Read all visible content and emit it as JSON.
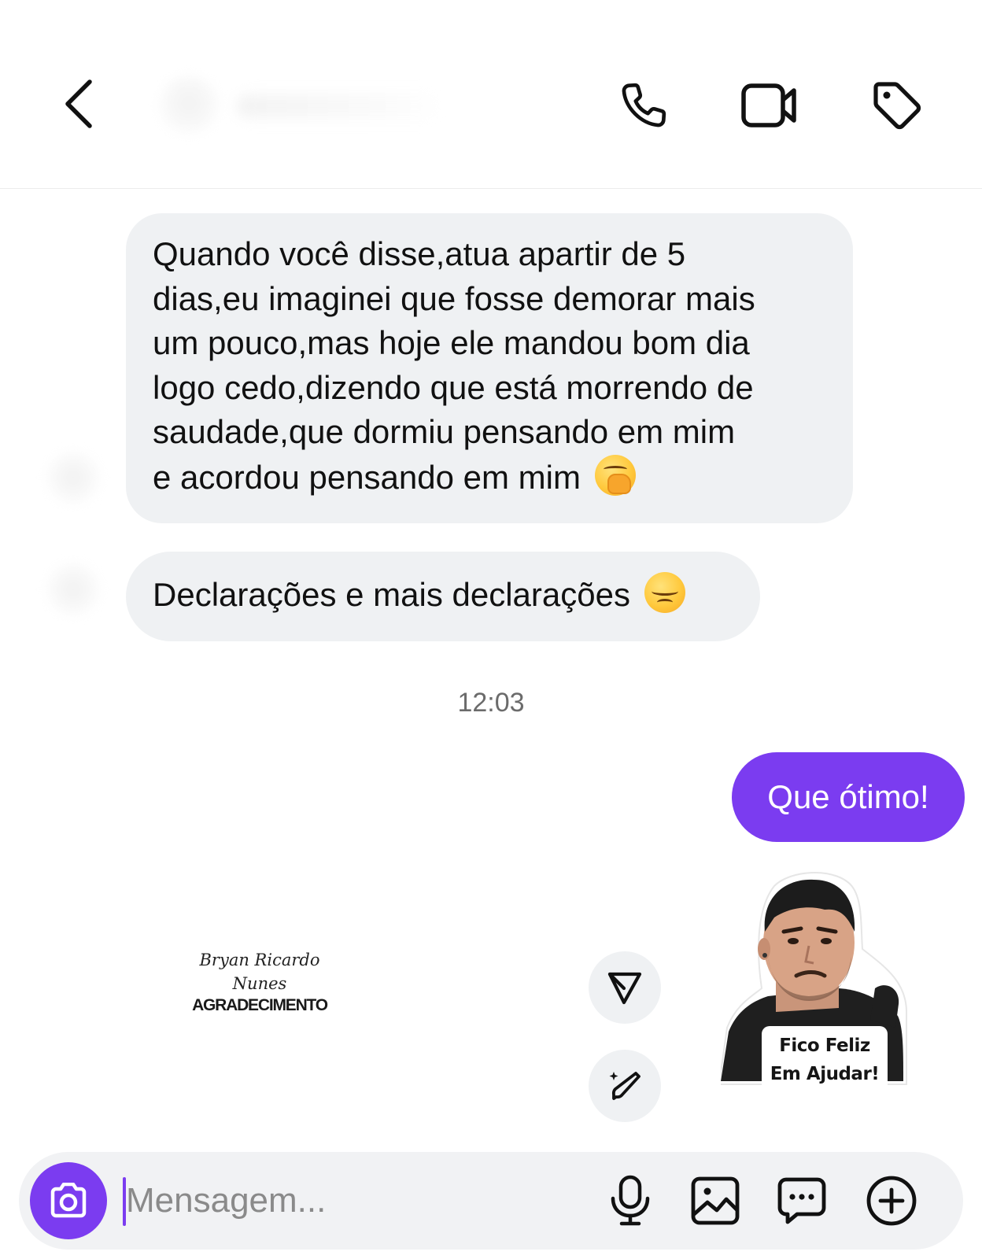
{
  "header": {
    "icons": {
      "back": "chevron-left-icon",
      "call": "phone-icon",
      "video": "video-camera-icon",
      "tag": "tag-icon"
    }
  },
  "messages": {
    "incoming": [
      {
        "lines": [
          "Quando você disse,atua apartir de 5",
          "dias,eu imaginei que fosse demorar mais",
          "um pouco,mas hoje ele mandou bom dia",
          "logo cedo,dizendo que está morrendo de",
          "saudade,que dormiu pensando em mim",
          "e acordou pensando em mim"
        ],
        "emoji": "hand-over-mouth-emoji"
      },
      {
        "text": "Declarações e mais declarações",
        "emoji": "relieved-face-emoji"
      }
    ],
    "timestamp": "12:03",
    "outgoing": [
      {
        "text": "Que ótimo!"
      }
    ],
    "sticker": {
      "caption_line1": "Fico Feliz",
      "caption_line2": "Em Ajudar!"
    }
  },
  "watermark": {
    "script_line1": "Bryan Ricardo",
    "script_line2": "Nunes",
    "caps": "AGRADECIMENTO"
  },
  "composer": {
    "placeholder": "Mensagem...",
    "icons": [
      "camera-icon",
      "microphone-icon",
      "gallery-icon",
      "sticker-icon",
      "plus-circle-icon"
    ]
  },
  "colors": {
    "accent": "#7b3cf0",
    "incoming_bubble": "#eff1f3",
    "outgoing_text": "#ffffff",
    "timestamp": "#6b6b6b"
  }
}
